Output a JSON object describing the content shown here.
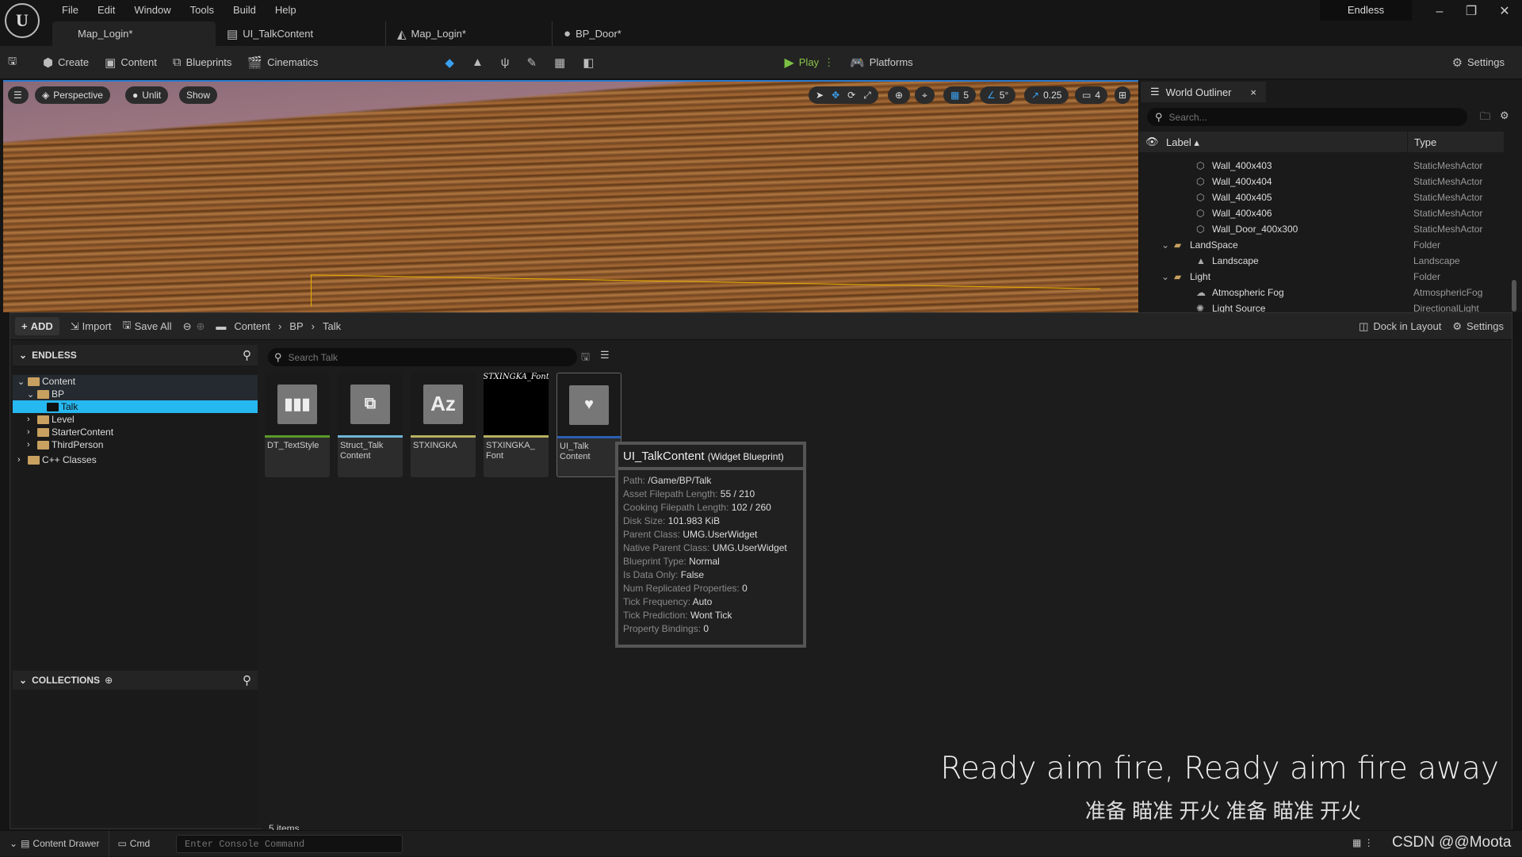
{
  "menu": [
    "File",
    "Edit",
    "Window",
    "Tools",
    "Build",
    "Help"
  ],
  "tabs": [
    {
      "label": "Map_Login*",
      "icon": "map-icon"
    },
    {
      "label": "UI_TalkContent",
      "icon": "widget-icon"
    },
    {
      "label": "Map_Login*",
      "icon": "landscape-icon"
    },
    {
      "label": "BP_Door*",
      "icon": "blueprint-icon"
    }
  ],
  "project": "Endless",
  "toolbar": {
    "create": "Create",
    "content": "Content",
    "blueprints": "Blueprints",
    "cinematics": "Cinematics",
    "play": "Play",
    "platforms": "Platforms",
    "settings": "Settings"
  },
  "viewport": {
    "perspective": "Perspective",
    "unlit": "Unlit",
    "show": "Show",
    "grid": "5",
    "angle": "5°",
    "scale": "0.25",
    "camera": "4"
  },
  "outliner": {
    "title": "World Outliner",
    "search_placeholder": "Search...",
    "col_label": "Label",
    "col_type": "Type",
    "rows": [
      {
        "label": "Wall_400x403",
        "type": "StaticMeshActor",
        "depth": 2,
        "icon": "mesh"
      },
      {
        "label": "Wall_400x404",
        "type": "StaticMeshActor",
        "depth": 2,
        "icon": "mesh"
      },
      {
        "label": "Wall_400x405",
        "type": "StaticMeshActor",
        "depth": 2,
        "icon": "mesh"
      },
      {
        "label": "Wall_400x406",
        "type": "StaticMeshActor",
        "depth": 2,
        "icon": "mesh"
      },
      {
        "label": "Wall_Door_400x300",
        "type": "StaticMeshActor",
        "depth": 2,
        "icon": "mesh"
      },
      {
        "label": "LandSpace",
        "type": "Folder",
        "depth": 1,
        "icon": "folder"
      },
      {
        "label": "Landscape",
        "type": "Landscape",
        "depth": 2,
        "icon": "landscape"
      },
      {
        "label": "Light",
        "type": "Folder",
        "depth": 1,
        "icon": "folder"
      },
      {
        "label": "Atmospheric Fog",
        "type": "AtmosphericFog",
        "depth": 2,
        "icon": "fog"
      },
      {
        "label": "Light Source",
        "type": "DirectionalLight",
        "depth": 2,
        "icon": "light"
      }
    ]
  },
  "content_browser": {
    "add": "ADD",
    "import": "Import",
    "save_all": "Save All",
    "breadcrumb": [
      "Content",
      "BP",
      "Talk"
    ],
    "dock": "Dock in Layout",
    "settings": "Settings",
    "project_header": "ENDLESS",
    "collections_header": "COLLECTIONS",
    "search_placeholder": "Search Talk",
    "item_count": "5 items",
    "tree": [
      {
        "label": "Content",
        "depth": 0,
        "open": true
      },
      {
        "label": "BP",
        "depth": 1,
        "open": true
      },
      {
        "label": "Talk",
        "depth": 2,
        "selected": true
      },
      {
        "label": "Level",
        "depth": 1
      },
      {
        "label": "StarterContent",
        "depth": 1
      },
      {
        "label": "ThirdPerson",
        "depth": 1
      },
      {
        "label": "C++ Classes",
        "depth": 0
      }
    ],
    "assets": [
      {
        "name": "DT_TextStyle",
        "color": "#5a9a2a",
        "icon": "data-table-icon"
      },
      {
        "name": "Struct_Talk Content",
        "color": "#6fb6d6",
        "icon": "struct-icon"
      },
      {
        "name": "STXINGKA",
        "color": "#b8b060",
        "icon": "font-icon"
      },
      {
        "name": "STXINGKA_ Font",
        "color": "#b8b060",
        "icon": "font-face-icon",
        "thumb_text": "STXINGKA_Font"
      },
      {
        "name": "UI_Talk Content",
        "color": "#2a5fb0",
        "icon": "widget-blueprint-icon"
      }
    ]
  },
  "tooltip": {
    "title": "UI_TalkContent",
    "kind": "(Widget Blueprint)",
    "lines": [
      [
        "Path:",
        "/Game/BP/Talk"
      ],
      [
        "Asset Filepath Length:",
        "55 / 210"
      ],
      [
        "Cooking Filepath Length:",
        "102 / 260"
      ],
      [
        "Disk Size:",
        "101.983 KiB"
      ],
      [
        "Parent Class:",
        "UMG.UserWidget"
      ],
      [
        "Native Parent Class:",
        "UMG.UserWidget"
      ],
      [
        "Blueprint Type:",
        "Normal"
      ],
      [
        "Is Data Only:",
        "False"
      ],
      [
        "Num Replicated Properties:",
        "0"
      ],
      [
        "Tick Frequency:",
        "Auto"
      ],
      [
        "Tick Prediction:",
        "Wont Tick"
      ],
      [
        "Property Bindings:",
        "0"
      ]
    ]
  },
  "subtitle": {
    "en": "Ready aim fire, Ready aim fire away",
    "zh": "准备 瞄准 开火 准备 瞄准 开火"
  },
  "statusbar": {
    "drawer": "Content Drawer",
    "cmd": "Cmd",
    "console_placeholder": "Enter Console Command",
    "watermark": "CSDN @@Moota"
  }
}
